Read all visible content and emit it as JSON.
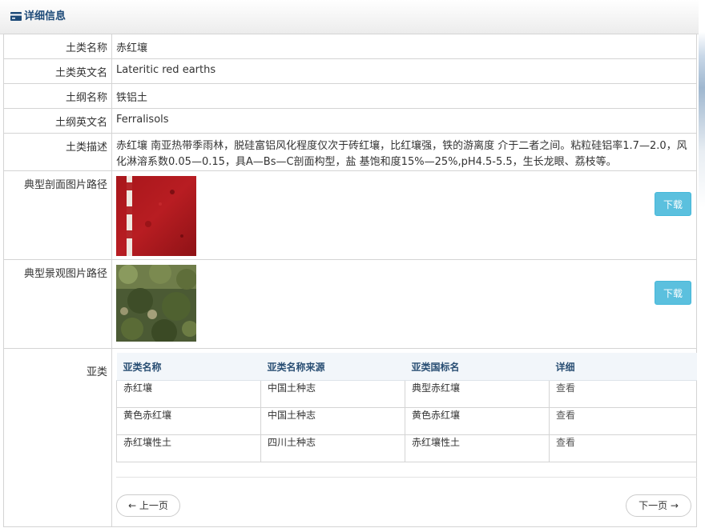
{
  "header": {
    "title": "详细信息",
    "icon": "card-icon"
  },
  "fields": {
    "name_label": "土类名称",
    "name_value": "赤红壤",
    "en_label": "土类英文名",
    "en_value": "Lateritic red earths",
    "order_label": "土纲名称",
    "order_value": "铁铝土",
    "order_en_label": "土纲英文名",
    "order_en_value": "Ferralisols",
    "desc_label": "土类描述",
    "desc_value": "赤红壤 南亚热带季雨林，脱硅富铝风化程度仅次于砖红壤，比红壤强，铁的游离度 介于二者之间。粘粒硅铝率1.7—2.0，风化淋溶系数0.05—0.15，具A—Bs—C剖面构型，盐 基饱和度15%—25%,pH4.5-5.5，生长龙眼、荔枝等。",
    "profile_label": "典型剖面图片路径",
    "landscape_label": "典型景观图片路径",
    "download_label": "下载",
    "subtypes_label": "亚类"
  },
  "subtypes": {
    "columns": [
      "亚类名称",
      "亚类名称来源",
      "亚类国标名",
      "详细"
    ],
    "rows": [
      [
        "赤红壤",
        "中国土种志",
        "典型赤红壤",
        "查看"
      ],
      [
        "黄色赤红壤",
        "中国土种志",
        "黄色赤红壤",
        "查看"
      ],
      [
        "赤红壤性土",
        "四川土种志",
        "赤红壤性土",
        "查看"
      ]
    ]
  },
  "pagination": {
    "prev": "← 上一页",
    "next": "下一页 →"
  },
  "colors": {
    "accent": "#1d4a78",
    "download": "#5bc0de"
  }
}
